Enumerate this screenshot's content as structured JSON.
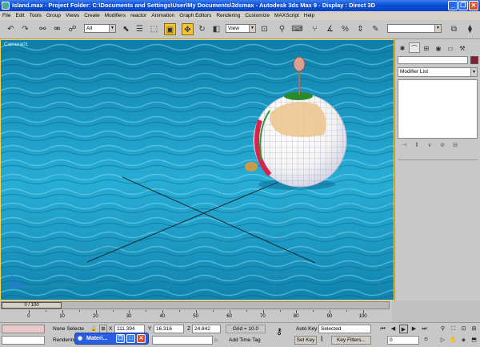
{
  "titlebar": {
    "text": "Island.max    - Project Folder: C:\\Documents and Settings\\User\\My Documents\\3dsmax    - Autodesk 3ds Max 9       - Display : Direct 3D"
  },
  "menu": [
    "File",
    "Edit",
    "Tools",
    "Group",
    "Views",
    "Create",
    "Modifiers",
    "reactor",
    "Animation",
    "Graph Editors",
    "Rendering",
    "Customize",
    "MAXScript",
    "Help"
  ],
  "toolbar": {
    "selection_filter": "All",
    "ref_coord": "View"
  },
  "viewport": {
    "label": "Camera01"
  },
  "command_panel": {
    "modifier_list": "Modifier List"
  },
  "time_slider": {
    "frame": "0 / 100"
  },
  "trackbar": {
    "ticks": [
      "0",
      "10",
      "20",
      "30",
      "40",
      "50",
      "60",
      "70",
      "80",
      "90",
      "100"
    ]
  },
  "status": {
    "selection": "None Selecte",
    "x_label": "X",
    "x": "111.394",
    "y_label": "Y",
    "y": "16.316",
    "z_label": "Z",
    "z": "24.842",
    "grid": "Grid = 10.0",
    "rendering": "Rendering",
    "add_time_tag": "Add Time Tag",
    "auto_key": "Auto Key",
    "set_key": "Set Key",
    "key_mode": "Selected",
    "key_filters": "Key Filters...",
    "frame_value": "0"
  },
  "taskbar": {
    "label": "Materi..."
  },
  "colors": {
    "accent": "#f4c430",
    "title": "#0a4fd8",
    "object_color": "#8b1a3a"
  }
}
